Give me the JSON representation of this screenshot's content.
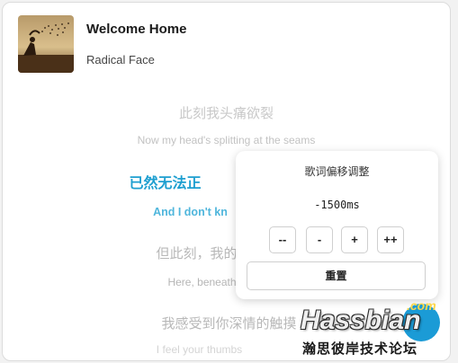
{
  "track": {
    "title": "Welcome Home",
    "artist": "Radical Face"
  },
  "lyrics": [
    {
      "zh": "此刻我头痛欲裂",
      "en": "Now my head's splitting at the seams",
      "active": false
    },
    {
      "zh": "已然无法正",
      "en": "And I don't kn",
      "active": true
    },
    {
      "zh": "但此刻，我的",
      "en": "Here, beneath",
      "active": false
    },
    {
      "zh": "我感受到你深情的触摸",
      "en": "I feel your thumbs",
      "active": false
    }
  ],
  "offset_popup": {
    "title": "歌词偏移调整",
    "value": "-1500ms",
    "buttons": [
      "--",
      "-",
      "+",
      "++"
    ],
    "reset_label": "重置"
  },
  "watermark": {
    "brand": "Hassbian",
    "com": ".com",
    "subtitle": "瀚思彼岸技术论坛"
  },
  "colors": {
    "active_lyric": "#1e9fd0",
    "watermark_blue": "#1b9bd6"
  }
}
